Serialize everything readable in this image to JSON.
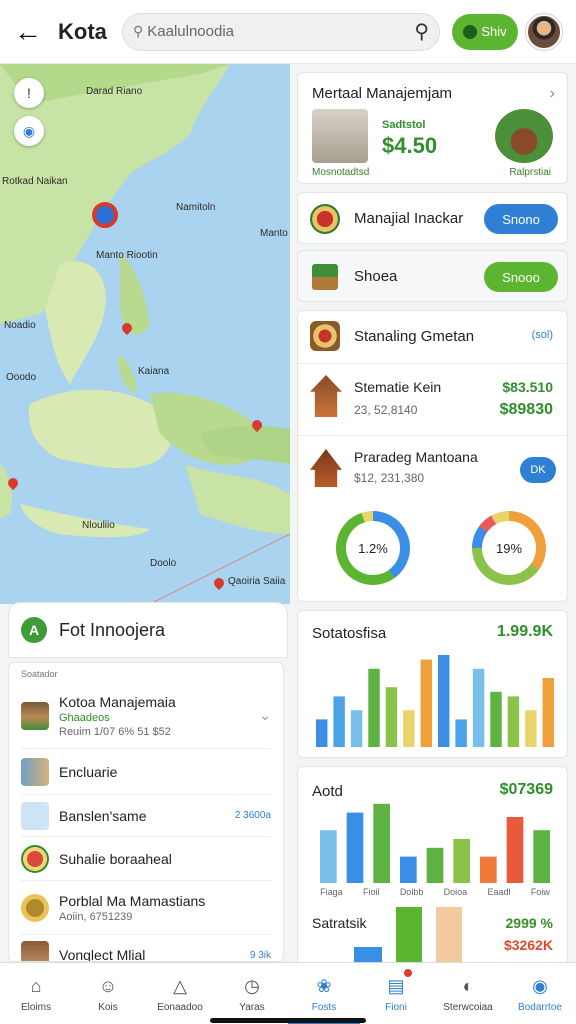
{
  "header": {
    "title": "Kota",
    "search_placeholder": "Kaalulnoodia",
    "action_label": "Shiv"
  },
  "map": {
    "labels": [
      "Darad Riano",
      "Rotkad Naikan",
      "Namitoln",
      "Manto",
      "Manto Riootin",
      "Noadio",
      "Ooodo",
      "Kaiana",
      "Nlouliio",
      "Qaoiria Saiia",
      "Doolo"
    ]
  },
  "panel": {
    "title": "Fot Innoojera",
    "section_label": "Soatador",
    "items": [
      {
        "label": "Kotoa Manajemaia",
        "sub1": "Ghaadeos",
        "sub2": "Reuim 1/07 6% 51 $52"
      },
      {
        "label": "Encluarie"
      },
      {
        "label": "Banslen'same",
        "right": "2 3600a"
      },
      {
        "label": "Suhalie boraaheal"
      },
      {
        "label": "Porblal Ma Mamastians",
        "sub1": "Aoiin, 6751239"
      },
      {
        "label": "Vonglect Mlial",
        "right": "9 3ik"
      }
    ]
  },
  "cards": {
    "featured": {
      "title": "Mertaal Manajemjam",
      "price_label": "Sadtstol",
      "price": "$4.50",
      "left_caption": "Mosnotadtsd",
      "right_caption": "Ralprstiai"
    },
    "managed": {
      "title": "Manajial Inackar",
      "button": "Snono"
    },
    "shoea": {
      "title": "Shoea",
      "button": "Snooo"
    },
    "standing": {
      "title": "Stanaling Gmetan",
      "tag": "(sol)",
      "item1": {
        "title": "Stematie Kein",
        "sub": "23, 52,8140",
        "value1": "$83.510",
        "value2": "$89830"
      },
      "item2": {
        "title": "Praradeg Mantoana",
        "sub": "$12, 231,380",
        "badge": "DK"
      },
      "donut1_label": "1.2%",
      "donut2_label": "19%"
    },
    "stats": {
      "title": "Sotatosfisa",
      "value": "1.99.9K"
    },
    "aotd": {
      "title": "Aotd",
      "value": "$07369",
      "x_labels": [
        "Fiaga",
        "Fioil",
        "Dolbb",
        "Doioa",
        "Eaadl",
        "Foiw"
      ],
      "bottom_title": "Satratsik",
      "bottom_value1": "2999 %",
      "bottom_value2": "$3262K"
    }
  },
  "bottom_nav": [
    {
      "label": "Eloims",
      "icon": "home-icon"
    },
    {
      "label": "Kois",
      "icon": "person-icon"
    },
    {
      "label": "Eonaadoo",
      "icon": "tent-icon"
    },
    {
      "label": "Yaras",
      "icon": "clock-icon"
    },
    {
      "label": "Fosts",
      "icon": "paw-icon"
    },
    {
      "label": "Fioni",
      "icon": "notes-icon"
    },
    {
      "label": "Sterwcoiaa",
      "icon": "gauge-icon"
    },
    {
      "label": "Bodarrtoe",
      "icon": "globe-icon"
    }
  ],
  "chart_data": [
    {
      "type": "bar",
      "title": "Sotatosfisa",
      "series": [
        {
          "values": [
            30,
            55,
            40,
            85,
            65,
            40,
            95,
            100,
            30,
            85,
            60,
            55,
            40,
            75
          ]
        }
      ],
      "colors": [
        "#3a8ee6",
        "#4aa3e8",
        "#78bfe9",
        "#5eb242",
        "#8bc34a",
        "#e9d46a",
        "#f0a03a"
      ]
    },
    {
      "type": "bar",
      "title": "Aotd",
      "series": [
        {
          "values": [
            60,
            80,
            90,
            30,
            40,
            50,
            30,
            75,
            60
          ]
        }
      ]
    }
  ]
}
